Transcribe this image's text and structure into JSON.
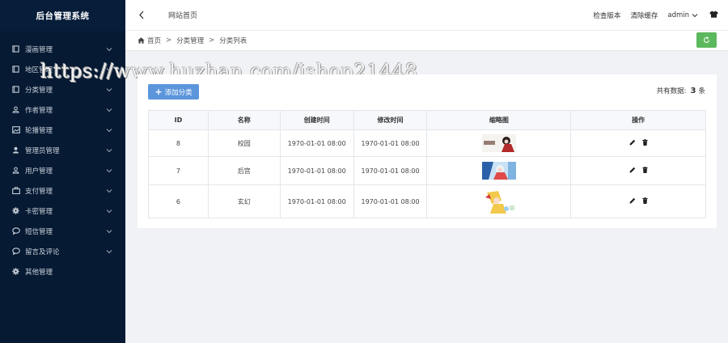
{
  "sidebar": {
    "brand": "后台管理系统",
    "items": [
      {
        "label": "漫画管理",
        "icon": "book-icon"
      },
      {
        "label": "地区管理",
        "icon": "book-icon"
      },
      {
        "label": "分类管理",
        "icon": "book-icon"
      },
      {
        "label": "作者管理",
        "icon": "user-icon"
      },
      {
        "label": "轮播管理",
        "icon": "image-icon"
      },
      {
        "label": "管理员管理",
        "icon": "user-solid-icon"
      },
      {
        "label": "用户管理",
        "icon": "user-icon"
      },
      {
        "label": "支付管理",
        "icon": "briefcase-icon"
      },
      {
        "label": "卡密管理",
        "icon": "gear-icon"
      },
      {
        "label": "短信管理",
        "icon": "comment-icon"
      },
      {
        "label": "留言及评论",
        "icon": "comment-icon"
      },
      {
        "label": "其他管理",
        "icon": "gear-icon"
      }
    ]
  },
  "header": {
    "title": "网站首页",
    "check_version": "检查版本",
    "clear_cache": "清除缓存",
    "user": "admin"
  },
  "breadcrumb": {
    "home": "首页",
    "level1": "分类管理",
    "level2": "分类列表"
  },
  "toolbar": {
    "add_label": "添加分类",
    "total_prefix": "共有数据:",
    "total_count": "3",
    "total_suffix": "条"
  },
  "table": {
    "headers": [
      "ID",
      "名称",
      "创建时间",
      "修改时间",
      "缩略图",
      "操作"
    ],
    "rows": [
      {
        "id": "8",
        "name": "校园",
        "created": "1970-01-01 08:00",
        "updated": "1970-01-01 08:00"
      },
      {
        "id": "7",
        "name": "后宫",
        "created": "1970-01-01 08:00",
        "updated": "1970-01-01 08:00"
      },
      {
        "id": "6",
        "name": "玄幻",
        "created": "1970-01-01 08:00",
        "updated": "1970-01-01 08:00"
      }
    ]
  },
  "watermark": "https://www.huzhan.com/ishop21448",
  "colors": {
    "sidebar_bg": "#061a33",
    "primary_button": "#5b95dc",
    "refresh_button": "#5cb85c"
  }
}
